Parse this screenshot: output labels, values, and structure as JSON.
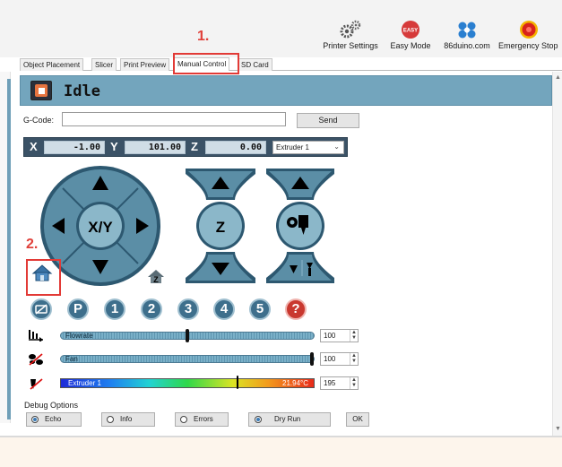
{
  "toolbar": {
    "buttons": [
      {
        "label": "Printer Settings",
        "icon": "gears-icon"
      },
      {
        "label": "Easy Mode",
        "icon": "easy-badge-icon",
        "badge": "EASY"
      },
      {
        "label": "86duino.com",
        "icon": "86duino-logo-icon"
      },
      {
        "label": "Emergency Stop",
        "icon": "emergency-stop-icon"
      }
    ]
  },
  "annotations": {
    "step1": "1.",
    "step2": "2."
  },
  "tabs": [
    "Object Placement",
    "Slicer",
    "Print Preview",
    "Manual Control",
    "SD Card"
  ],
  "active_tab": "Manual Control",
  "status": {
    "text": "Idle"
  },
  "gcode": {
    "label": "G-Code:",
    "value": "",
    "send_label": "Send"
  },
  "coords": {
    "x_label": "X",
    "x_value": "-1.00",
    "y_label": "Y",
    "y_value": "101.00",
    "z_label": "Z",
    "z_value": "0.00",
    "extruder": "Extruder 1"
  },
  "jog": {
    "xy_label": "X/Y",
    "z_label": "Z",
    "home_z_label": "Z"
  },
  "preset_buttons": [
    "P",
    "1",
    "2",
    "3",
    "4",
    "5",
    "?"
  ],
  "sliders": {
    "flowrate": {
      "label": "Flowrate",
      "value": "100",
      "level_fraction": 0.5
    },
    "fan": {
      "label": "Fan",
      "value": "100",
      "level_fraction": 1.0
    },
    "extruder": {
      "label": "Extruder 1",
      "temp": "21.94°C",
      "value": "195",
      "level_fraction": 0.7
    }
  },
  "debug": {
    "title": "Debug Options",
    "buttons": [
      {
        "label": "Echo",
        "on": true
      },
      {
        "label": "Info",
        "on": false
      },
      {
        "label": "Errors",
        "on": false
      },
      {
        "label": "Dry Run",
        "on": true
      }
    ],
    "ok_label": "OK"
  },
  "colors": {
    "status_bar": "#73a5bd",
    "jog_fill": "#5b8ea6",
    "annotation": "#e23a36"
  }
}
